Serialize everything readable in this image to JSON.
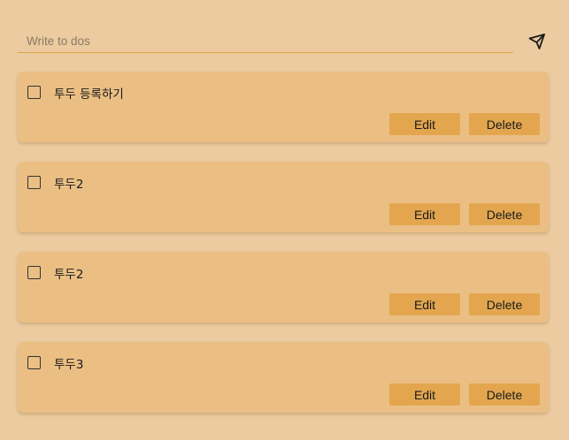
{
  "input": {
    "placeholder": "Write to dos",
    "value": ""
  },
  "send_button": {
    "icon": "send-icon"
  },
  "todos": [
    {
      "text": "투두 등록하기",
      "checked": false,
      "edit_label": "Edit",
      "delete_label": "Delete"
    },
    {
      "text": "투두2",
      "checked": false,
      "edit_label": "Edit",
      "delete_label": "Delete"
    },
    {
      "text": "투두2",
      "checked": false,
      "edit_label": "Edit",
      "delete_label": "Delete"
    },
    {
      "text": "투두3",
      "checked": false,
      "edit_label": "Edit",
      "delete_label": "Delete"
    }
  ],
  "colors": {
    "background": "#ebcb9f",
    "card": "#ebbf84",
    "button": "#e3a64f",
    "input_underline": "#e0a24a"
  }
}
